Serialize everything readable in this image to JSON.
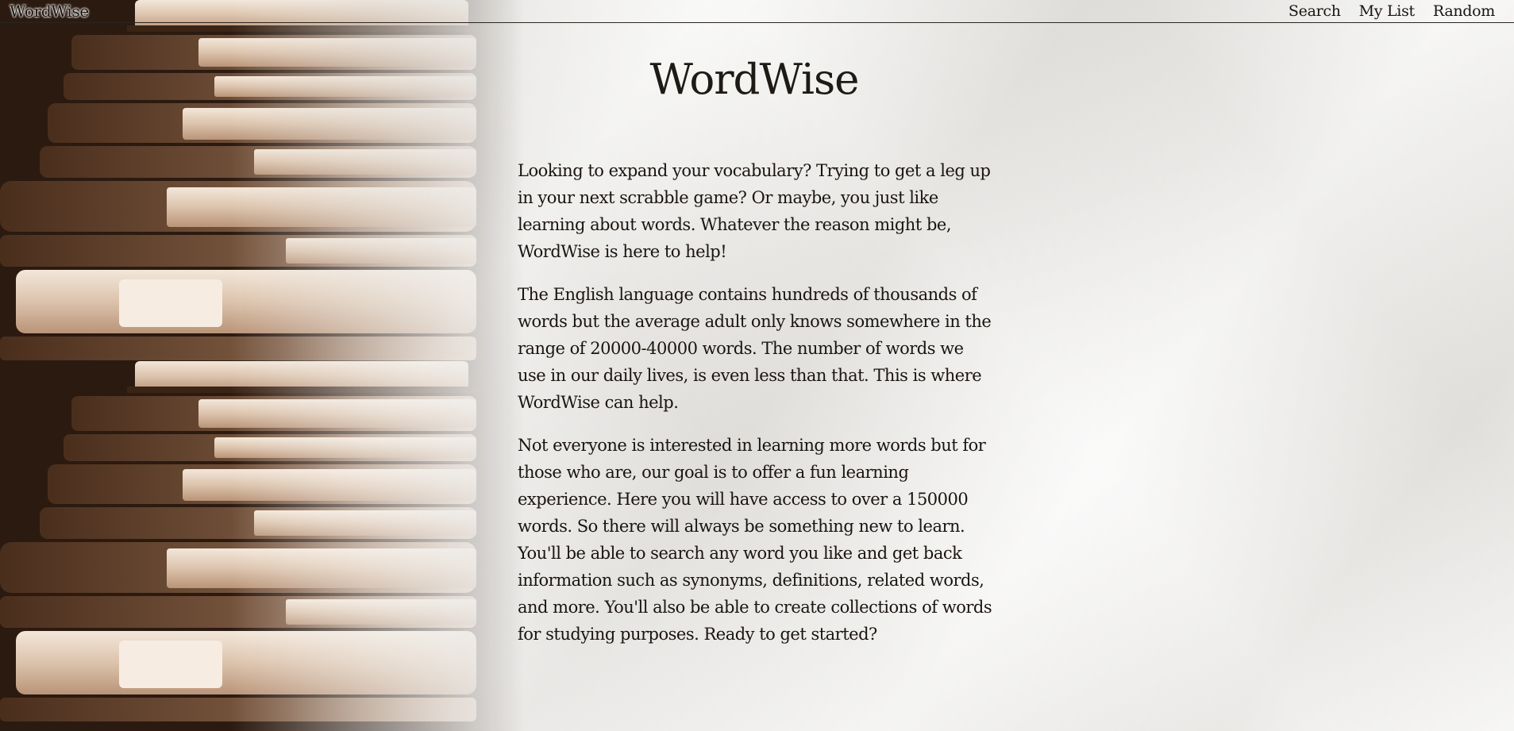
{
  "nav": {
    "brand": "WordWise",
    "links": [
      {
        "label": "Search"
      },
      {
        "label": "My List"
      },
      {
        "label": "Random"
      }
    ]
  },
  "main": {
    "title": "WordWise",
    "paragraphs": [
      "Looking to expand your vocabulary? Trying to get a leg up in your next scrabble game? Or maybe, you just like learning about words. Whatever the reason might be, WordWise is here to help!",
      "The English language contains hundreds of thousands of words but the average adult only knows somewhere in the range of 20000-40000 words. The number of words we use in our daily lives, is even less than that. This is where WordWise can help.",
      "Not everyone is interested in learning more words but for those who are, our goal is to offer a fun learning experience. Here you will have access to over a 150000 words. So there will always be something new to learn. You'll be able to search any word you like and get back information such as synonyms, definitions, related words, and more. You'll also be able to create collections of words for studying purposes. Ready to get started?"
    ]
  },
  "colors": {
    "text": "#1a1410",
    "paper": "#ebeae7",
    "book_dark": "#2a1a10",
    "book_light": "#e8d6c4"
  }
}
